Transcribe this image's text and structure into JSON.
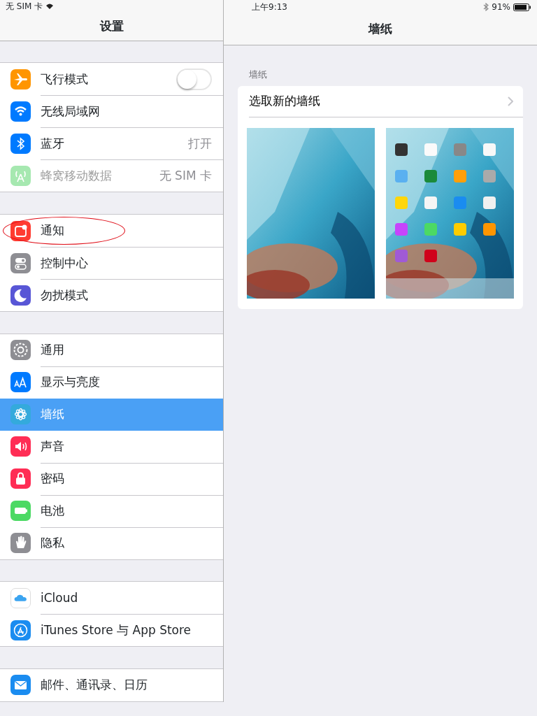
{
  "status_bar": {
    "carrier": "无 SIM 卡",
    "time": "上午9:13",
    "battery": "91%"
  },
  "sidebar": {
    "title": "设置",
    "groups": [
      [
        {
          "label": "飞行模式",
          "kind": "toggle",
          "on": false,
          "selected": false,
          "disabled": false,
          "color": "#ff9500"
        },
        {
          "label": "无线局域网",
          "kind": "plain",
          "selected": false,
          "disabled": false,
          "color": "#007aff"
        },
        {
          "label": "蓝牙",
          "value": "打开",
          "kind": "plain",
          "selected": false,
          "disabled": false,
          "color": "#007aff"
        },
        {
          "label": "蜂窝移动数据",
          "value": "无 SIM 卡",
          "kind": "plain",
          "selected": false,
          "disabled": true,
          "color": "#a6e8b0"
        }
      ],
      [
        {
          "label": "通知",
          "kind": "plain",
          "selected": false,
          "disabled": false,
          "circled": true,
          "color": "#ff3b30"
        },
        {
          "label": "控制中心",
          "kind": "plain",
          "selected": false,
          "disabled": false,
          "color": "#8e8e93"
        },
        {
          "label": "勿扰模式",
          "kind": "plain",
          "selected": false,
          "disabled": false,
          "color": "#5856d6"
        }
      ],
      [
        {
          "label": "通用",
          "kind": "plain",
          "selected": false,
          "disabled": false,
          "color": "#8e8e93"
        },
        {
          "label": "显示与亮度",
          "kind": "plain",
          "selected": false,
          "disabled": false,
          "color": "#007aff"
        },
        {
          "label": "墙纸",
          "kind": "plain",
          "selected": true,
          "disabled": false,
          "color": "#34aadc"
        },
        {
          "label": "声音",
          "kind": "plain",
          "selected": false,
          "disabled": false,
          "color": "#ff2d55"
        },
        {
          "label": "密码",
          "kind": "plain",
          "selected": false,
          "disabled": false,
          "color": "#ff2d55"
        },
        {
          "label": "电池",
          "kind": "plain",
          "selected": false,
          "disabled": false,
          "color": "#4cd964"
        },
        {
          "label": "隐私",
          "kind": "plain",
          "selected": false,
          "disabled": false,
          "color": "#8e8e93"
        }
      ],
      [
        {
          "label": "iCloud",
          "kind": "plain",
          "selected": false,
          "disabled": false,
          "color": "#ffffff"
        },
        {
          "label": "iTunes Store 与 App Store",
          "kind": "plain",
          "selected": false,
          "disabled": false,
          "color": "#1a8cf0"
        }
      ],
      [
        {
          "label": "邮件、通讯录、日历",
          "kind": "plain",
          "selected": false,
          "disabled": false,
          "color": "#1a8cf0"
        }
      ]
    ]
  },
  "detail": {
    "title": "墙纸",
    "section_header": "墙纸",
    "choose_row": "选取新的墙纸"
  }
}
